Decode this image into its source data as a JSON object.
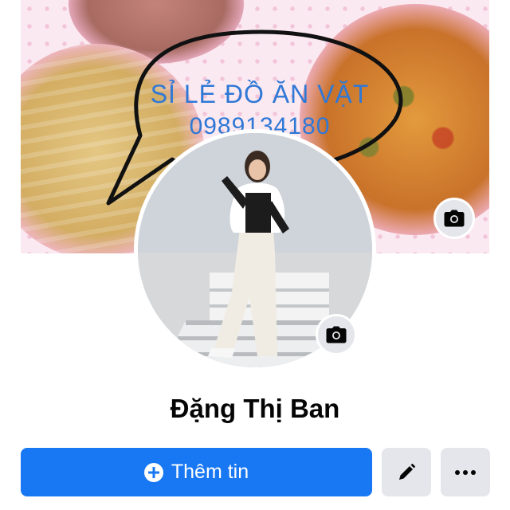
{
  "profile": {
    "name": "Đặng Thị Ban",
    "cover": {
      "line1": "SỈ LẺ ĐỒ ĂN VẶT",
      "line2": "0989134180",
      "camera_icon": "camera-icon"
    },
    "avatar": {
      "camera_icon": "camera-icon"
    }
  },
  "actions": {
    "add_story_label": "Thêm tin",
    "add_icon": "plus-circle-icon",
    "edit_icon": "pencil-icon",
    "more_icon": "more-icon"
  },
  "colors": {
    "primary": "#1877f2",
    "secondary_button": "#e4e6eb",
    "cover_text": "#2f78d6"
  }
}
